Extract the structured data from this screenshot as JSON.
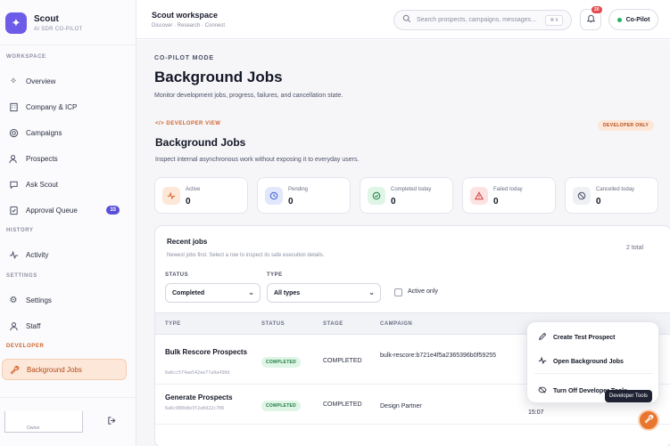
{
  "brand": {
    "name": "Scout",
    "subtitle": "AI SDR CO-PILOT"
  },
  "sidebar": {
    "sections": {
      "workspace": "WORKSPACE",
      "history": "HISTORY",
      "settings": "SETTINGS",
      "developer": "DEVELOPER"
    },
    "items": [
      {
        "label": "Overview",
        "icon": "sparkle-icon"
      },
      {
        "label": "Company & ICP",
        "icon": "building-icon"
      },
      {
        "label": "Campaigns",
        "icon": "target-icon"
      },
      {
        "label": "Prospects",
        "icon": "users-icon"
      },
      {
        "label": "Ask Scout",
        "icon": "chat-icon"
      },
      {
        "label": "Approval Queue",
        "icon": "approval-icon",
        "badge": "33"
      },
      {
        "label": "Activity",
        "icon": "activity-icon"
      },
      {
        "label": "Settings",
        "icon": "gear-icon"
      },
      {
        "label": "Staff",
        "icon": "staff-icon"
      },
      {
        "label": "Background Jobs",
        "icon": "wrench-icon",
        "active": true
      }
    ],
    "user_role": "Owner"
  },
  "header": {
    "title": "Scout workspace",
    "breadcrumb": "Discover · Research · Connect",
    "search_placeholder": "Search prospects, campaigns, messages…",
    "search_shortcut": "⌘ K",
    "notifications_count": "20",
    "copilot_label": "Co-Pilot"
  },
  "page": {
    "mode_label": "CO-PILOT MODE",
    "title": "Background Jobs",
    "description": "Monitor development jobs, progress, failures, and cancellation state."
  },
  "dev_view": {
    "label": "DEVELOPER VIEW",
    "badge": "DEVELOPER ONLY",
    "title": "Background Jobs",
    "description": "Inspect internal asynchronous work without exposing it to everyday users."
  },
  "stats": [
    {
      "label": "Active",
      "value": "0",
      "icon": "activity-icon",
      "color": "#fde7d8",
      "icon_color": "#d2642a"
    },
    {
      "label": "Pending",
      "value": "0",
      "icon": "clock-icon",
      "color": "#e2e8fb",
      "icon_color": "#3b5bd1"
    },
    {
      "label": "Completed today",
      "value": "0",
      "icon": "check-circle-icon",
      "color": "#dff5e6",
      "icon_color": "#1f7a44"
    },
    {
      "label": "Failed today",
      "value": "0",
      "icon": "warning-icon",
      "color": "#fde2e2",
      "icon_color": "#d23a3a"
    },
    {
      "label": "Cancelled today",
      "value": "0",
      "icon": "ban-icon",
      "color": "#eef0f4",
      "icon_color": "#4c5066"
    }
  ],
  "jobs": {
    "title": "Recent jobs",
    "subtitle": "Newest jobs first. Select a row to inspect its safe execution details.",
    "total": "2 total",
    "filters": {
      "status_label": "STATUS",
      "status_value": "Completed",
      "type_label": "TYPE",
      "type_value": "All types",
      "active_only_label": "Active only"
    },
    "columns": [
      "TYPE",
      "STATUS",
      "STAGE",
      "CAMPAIGN"
    ],
    "rows": [
      {
        "name": "Bulk Rescore Prospects",
        "id": "6a6cc574ae542ee7?a9a430d",
        "status": "COMPLETED",
        "stage": "COMPLETED",
        "campaign": "bulk-rescore:b721e4f5a2365396b0f59255",
        "time": ""
      },
      {
        "name": "Generate Prospects",
        "id": "6a6c980b8e3f2a0d22c706",
        "status": "COMPLETED",
        "stage": "COMPLETED",
        "campaign": "Design Partner",
        "time": "15:07"
      }
    ]
  },
  "dev_menu": {
    "items": [
      {
        "label": "Create Test Prospect",
        "icon": "pencil-icon"
      },
      {
        "label": "Open Background Jobs",
        "icon": "activity-icon"
      },
      {
        "label": "Turn Off Developer Tools",
        "icon": "eye-off-icon"
      }
    ],
    "tooltip": "Developer Tools"
  }
}
